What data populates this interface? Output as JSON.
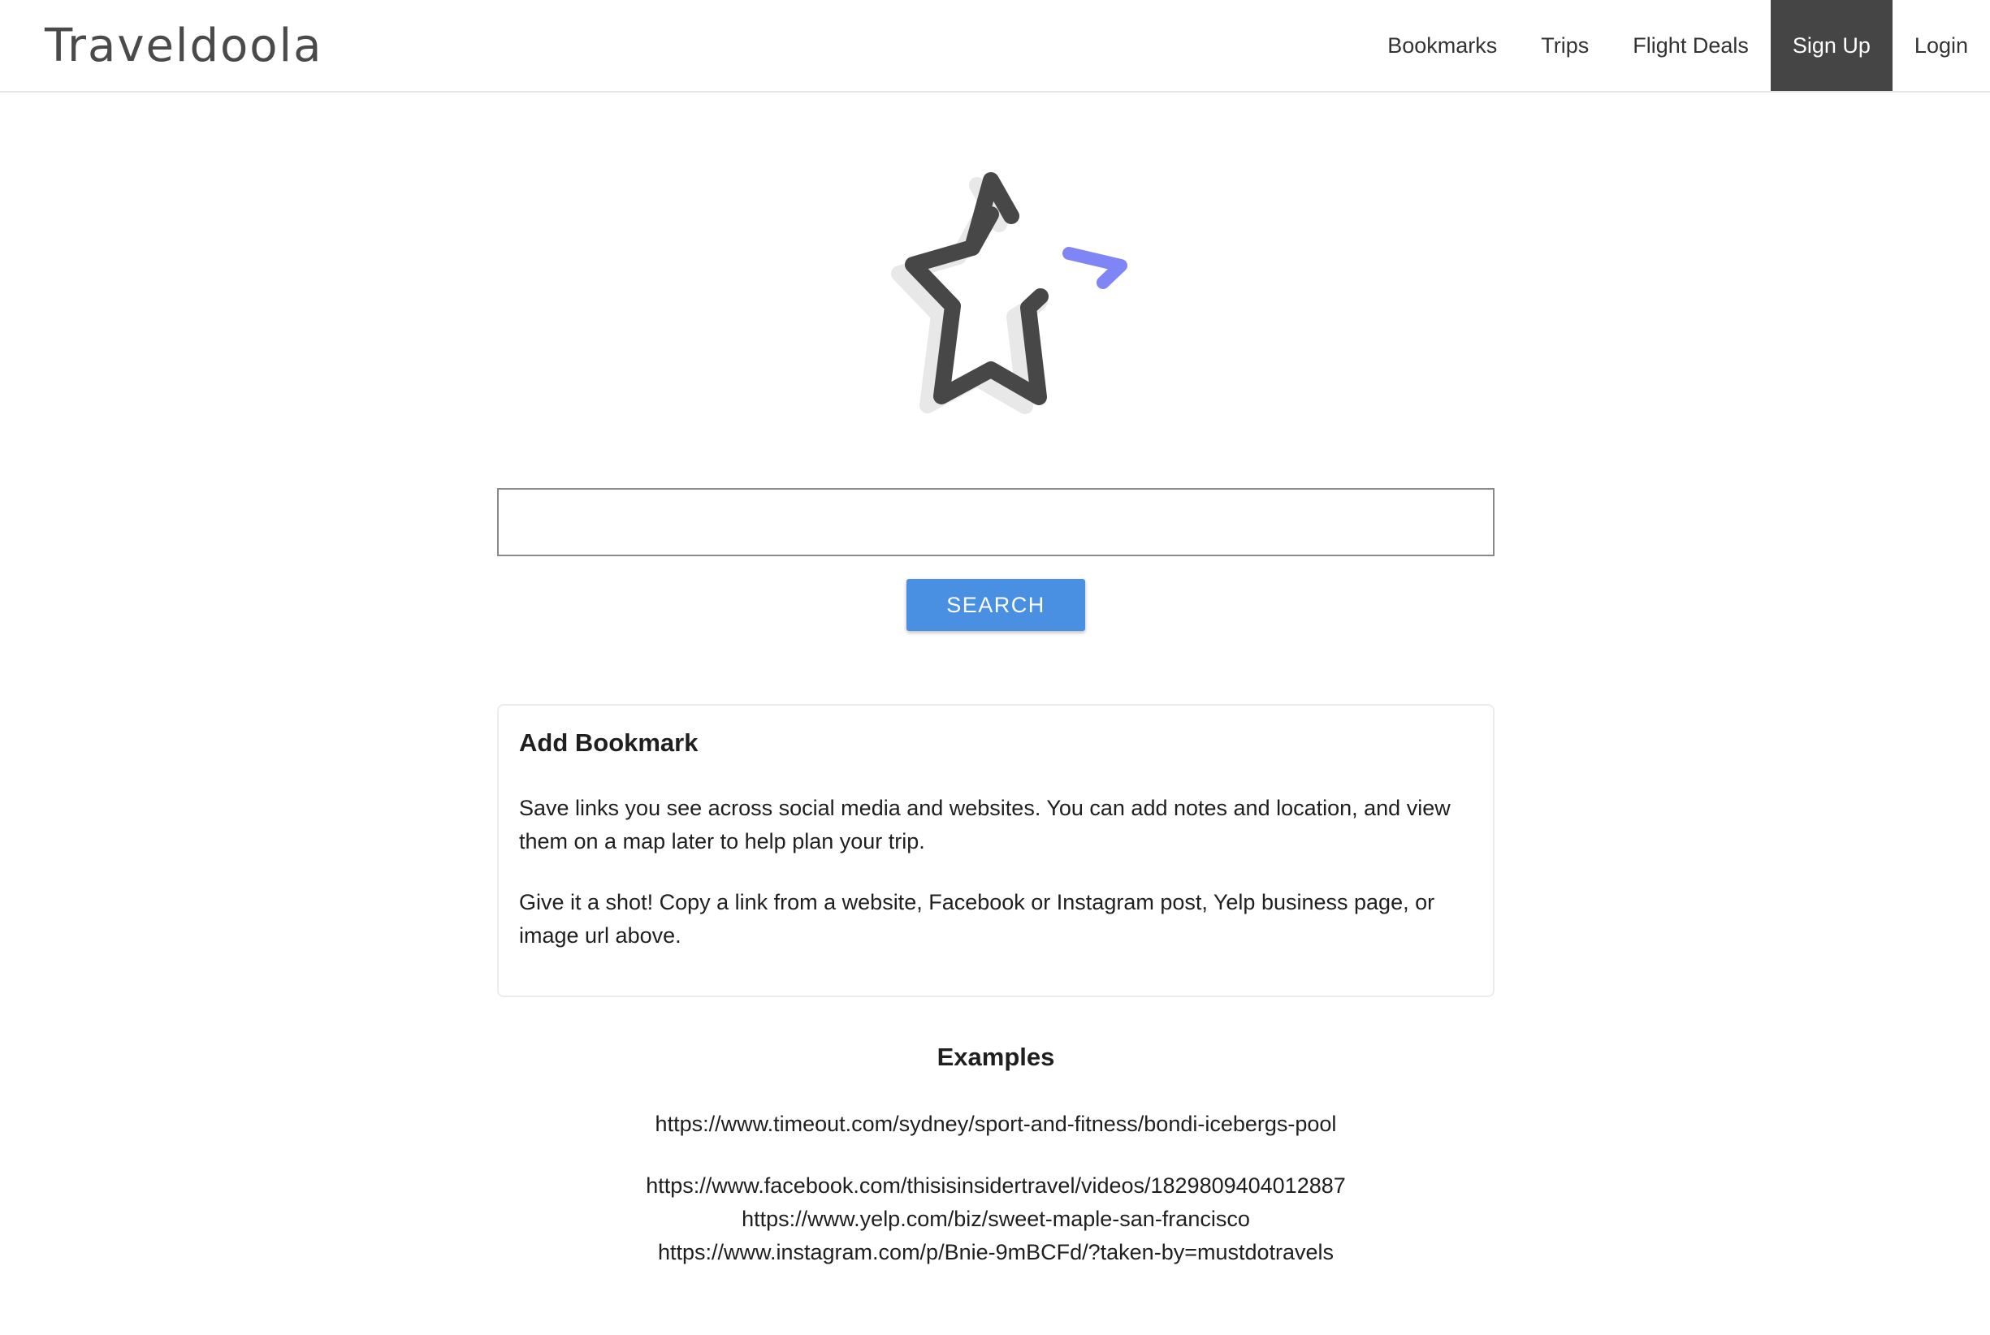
{
  "header": {
    "logo_text": "Traveldoola",
    "nav": {
      "bookmarks": "Bookmarks",
      "trips": "Trips",
      "flight_deals": "Flight Deals",
      "sign_up": "Sign Up",
      "login": "Login"
    }
  },
  "hero": {
    "icon": "star-bookmark-icon",
    "icon_colors": {
      "star": "#474747",
      "shadow": "#e8e8e8",
      "accent": "#7f85f5"
    }
  },
  "search": {
    "value": "",
    "placeholder": "",
    "button_label": "SEARCH"
  },
  "card": {
    "title": "Add Bookmark",
    "paragraph_1": "Save links you see across social media and websites. You can add notes and location, and view them on a map later to help plan your trip.",
    "paragraph_2": "Give it a shot! Copy a link from a website, Facebook or Instagram post, Yelp business page, or image url above."
  },
  "examples": {
    "title": "Examples",
    "links": [
      "https://www.timeout.com/sydney/sport-and-fitness/bondi-icebergs-pool",
      "https://www.facebook.com/thisisinsidertravel/videos/1829809404012887",
      "https://www.yelp.com/biz/sweet-maple-san-francisco",
      "https://www.instagram.com/p/Bnie-9mBCFd/?taken-by=mustdotravels"
    ]
  },
  "colors": {
    "active_nav_bg": "#454545",
    "button_bg": "#4a90e2"
  }
}
